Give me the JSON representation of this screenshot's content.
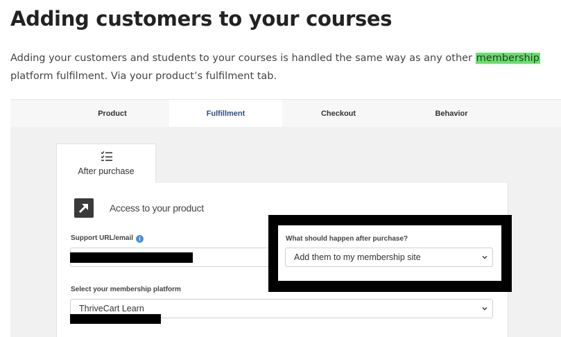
{
  "article": {
    "title": "Adding customers to your courses",
    "intro_before": "Adding your customers and students to your courses is handled the same way as any other ",
    "intro_highlight": "membership",
    "intro_after": " platform fulfilment. Via your product’s fulfilment tab."
  },
  "tabs": [
    {
      "label": "Product",
      "active": false
    },
    {
      "label": "Fulfillment",
      "active": true
    },
    {
      "label": "Checkout",
      "active": false
    },
    {
      "label": "Behavior",
      "active": false
    }
  ],
  "sub_tab": {
    "label": "After purchase",
    "icon": "checklist-icon"
  },
  "section": {
    "title": "Access to your product",
    "icon": "external-link-icon"
  },
  "support": {
    "label": "Support URL/email",
    "value": "",
    "info_icon": "info-icon"
  },
  "after_purchase": {
    "label": "What should happen after purchase?",
    "selected": "Add them to my membership site"
  },
  "platform": {
    "label": "Select your membership platform",
    "selected": "ThriveCart Learn"
  },
  "colors": {
    "highlight": "#66e06a",
    "active_tab_text": "#2d4f7d",
    "info_blue": "#4a90d9"
  }
}
